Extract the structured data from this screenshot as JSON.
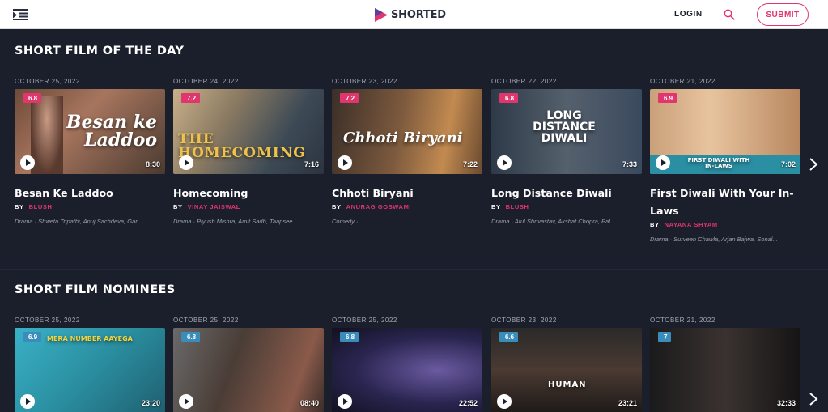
{
  "header": {
    "brand": "SHORTED",
    "login_label": "LOGIN",
    "submit_label": "SUBMIT",
    "accent": "#e0356d"
  },
  "sections": [
    {
      "title": "SHORT FILM OF THE DAY",
      "cards": [
        {
          "date": "OCTOBER 25, 2022",
          "rating": "6.8",
          "duration": "8:30",
          "overlay": "Besan ke Laddoo",
          "title": "Besan Ke Laddoo",
          "by": "BY",
          "creator": "BLUSH",
          "meta": "Drama · Shweta Tripathi, Anuj Sachdeva, Gar..."
        },
        {
          "date": "OCTOBER 24, 2022",
          "rating": "7.2",
          "duration": "7:16",
          "overlay": "THE HOMECOMING",
          "title": "Homecoming",
          "by": "BY",
          "creator": "VINAY JAISWAL",
          "meta": "Drama · Piyush Mishra, Amit Sadh, Taapsee ..."
        },
        {
          "date": "OCTOBER 23, 2022",
          "rating": "7.2",
          "duration": "7:22",
          "overlay": "Chhoti Biryani",
          "title": "Chhoti Biryani",
          "by": "BY",
          "creator": "ANURAG GOSWAMI",
          "meta": "Comedy ·"
        },
        {
          "date": "OCTOBER 22, 2022",
          "rating": "6.8",
          "duration": "7:33",
          "overlay": "LONG DISTANCE DIWALI",
          "title": "Long Distance Diwali",
          "by": "BY",
          "creator": "BLUSH",
          "meta": "Drama · Atul Shrivastav, Akshat Chopra, Pal..."
        },
        {
          "date": "OCTOBER 21, 2022",
          "rating": "6.9",
          "duration": "7:02",
          "overlay": "FIRST DIWALI WITH IN-LAWS",
          "title": "First Diwali With Your In-Laws",
          "by": "BY",
          "creator": "NAYANA SHYAM",
          "meta": "Drama · Surveen Chawla, Arjan Bajwa, Sonal..."
        }
      ]
    },
    {
      "title": "SHORT FILM NOMINEES",
      "cards": [
        {
          "date": "OCTOBER 25, 2022",
          "rating": "6.9",
          "duration": "23:20",
          "overlay": "MERA NUMBER AAYEGA"
        },
        {
          "date": "OCTOBER 25, 2022",
          "rating": "6.8",
          "duration": "08:40",
          "overlay": ""
        },
        {
          "date": "OCTOBER 25, 2022",
          "rating": "6.8",
          "duration": "22:52",
          "overlay": ""
        },
        {
          "date": "OCTOBER 23, 2022",
          "rating": "6.6",
          "duration": "23:21",
          "overlay": "HUMAN"
        },
        {
          "date": "OCTOBER 21, 2022",
          "rating": "7",
          "duration": "32:33",
          "overlay": ""
        }
      ]
    }
  ],
  "icons": {
    "menu": "menu-icon",
    "search": "search-icon",
    "play": "play-icon",
    "next": "chevron-right-icon"
  }
}
